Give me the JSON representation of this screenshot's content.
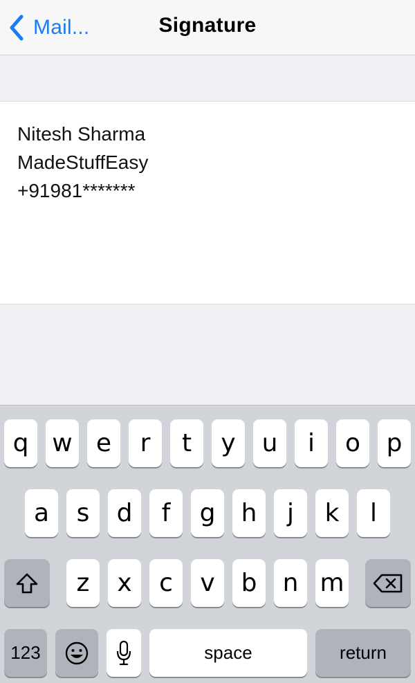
{
  "navbar": {
    "back_label": "Mail...",
    "title": "Signature"
  },
  "signature": {
    "lines": [
      "Nitesh Sharma",
      "MadeStuffEasy",
      "+91981*******"
    ]
  },
  "keyboard": {
    "row1": [
      "q",
      "w",
      "e",
      "r",
      "t",
      "y",
      "u",
      "i",
      "o",
      "p"
    ],
    "row2": [
      "a",
      "s",
      "d",
      "f",
      "g",
      "h",
      "j",
      "k",
      "l"
    ],
    "row3": [
      "z",
      "x",
      "c",
      "v",
      "b",
      "n",
      "m"
    ],
    "numbers_label": "123",
    "space_label": "space",
    "return_label": "return",
    "icons": {
      "shift": "shift-icon",
      "delete": "delete-icon",
      "emoji": "emoji-icon",
      "mic": "microphone-icon",
      "back": "chevron-left-icon"
    },
    "accent_color": "#1a7cf5"
  }
}
